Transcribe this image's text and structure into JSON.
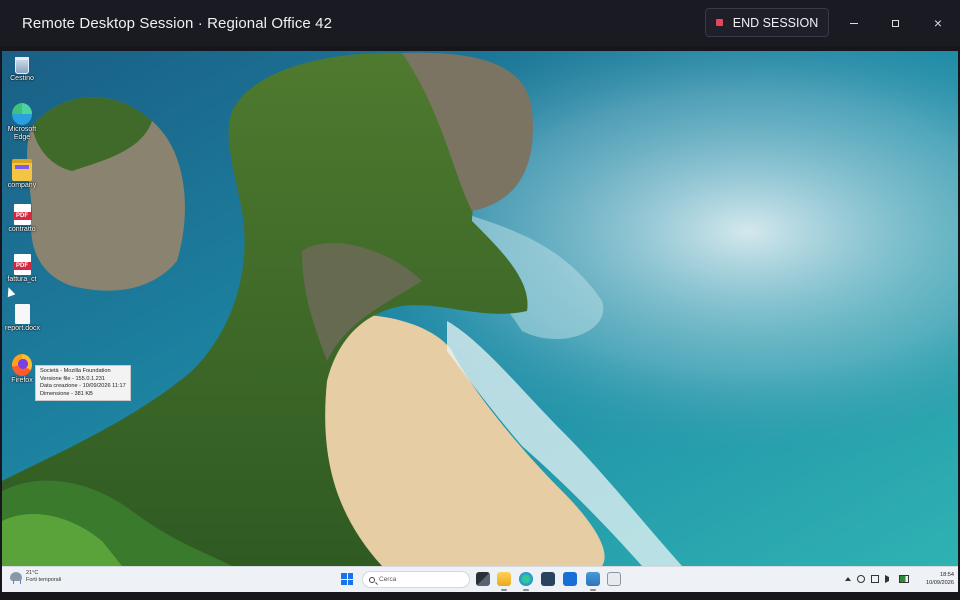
{
  "window": {
    "title": "Remote Desktop Session · Regional Office 42",
    "end_session_label": "END SESSION",
    "minimize_label": "Minimize",
    "maximize_label": "Maximize",
    "close_label": "×"
  },
  "desktop_icons": [
    {
      "label": "Cestino",
      "icon": "recycle-bin-icon"
    },
    {
      "label": "Microsoft Edge",
      "icon": "edge-icon"
    },
    {
      "label": "company",
      "icon": "folder-icon"
    },
    {
      "label": "contratto",
      "icon": "pdf-icon"
    },
    {
      "label": "fattura_ct",
      "icon": "pdf-icon"
    },
    {
      "label": "report.docx",
      "icon": "document-icon"
    },
    {
      "label": "Firefox",
      "icon": "firefox-icon"
    }
  ],
  "tooltip": {
    "lines": [
      "Società - Mozilla Foundation",
      "Versione file - 155.0.1.231",
      "Data creazione - 10/09/2026 11:17",
      "Dimensione - 381 KB"
    ]
  },
  "taskbar": {
    "weather_temp": "21°C",
    "weather_desc": "Forti temporali",
    "search_placeholder": "Cerca",
    "apps": [
      "task-view",
      "file-explorer",
      "edge",
      "store",
      "outlook",
      "notepad",
      "snipping-tool"
    ],
    "clock_time": "18:54",
    "clock_date": "10/09/2026"
  },
  "colors": {
    "title_bg": "#1a1a22",
    "end_session_accent": "#e2485a",
    "taskbar_bg": "#eef1f5"
  }
}
